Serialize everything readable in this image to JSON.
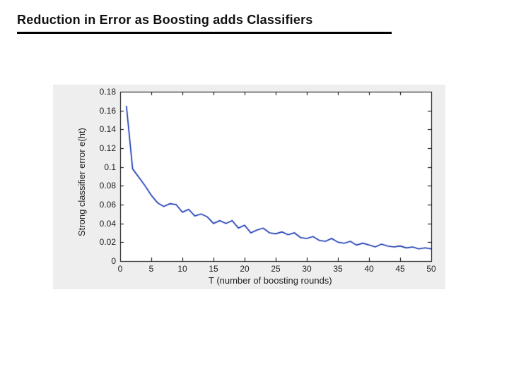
{
  "title": "Reduction in Error as Boosting adds Classifiers",
  "chart_data": {
    "type": "line",
    "xlabel": "T (number of boosting rounds)",
    "ylabel": "Strong classifier error e(ht)",
    "xlim": [
      0,
      50
    ],
    "ylim": [
      0,
      0.18
    ],
    "x_ticks": [
      0,
      5,
      10,
      15,
      20,
      25,
      30,
      35,
      40,
      45,
      50
    ],
    "y_ticks": [
      0,
      0.02,
      0.04,
      0.06,
      0.08,
      0.1,
      0.12,
      0.14,
      0.16,
      0.18
    ],
    "y_tick_labels": [
      "0",
      "0.02",
      "0.04",
      "0.06",
      "0.08",
      "0.1",
      "0.12",
      "0.14",
      "0.16",
      "0.18"
    ],
    "line_color": "#1030b0",
    "x": [
      1,
      2,
      3,
      4,
      5,
      6,
      7,
      8,
      9,
      10,
      11,
      12,
      13,
      14,
      15,
      16,
      17,
      18,
      19,
      20,
      21,
      22,
      23,
      24,
      25,
      26,
      27,
      28,
      29,
      30,
      31,
      32,
      33,
      34,
      35,
      36,
      37,
      38,
      39,
      40,
      41,
      42,
      43,
      44,
      45,
      46,
      47,
      48,
      49,
      50
    ],
    "y": [
      0.165,
      0.098,
      0.089,
      0.08,
      0.07,
      0.062,
      0.058,
      0.061,
      0.06,
      0.052,
      0.055,
      0.048,
      0.05,
      0.047,
      0.04,
      0.043,
      0.04,
      0.043,
      0.035,
      0.038,
      0.03,
      0.033,
      0.035,
      0.03,
      0.029,
      0.031,
      0.028,
      0.03,
      0.025,
      0.024,
      0.026,
      0.022,
      0.021,
      0.024,
      0.02,
      0.019,
      0.021,
      0.017,
      0.019,
      0.017,
      0.015,
      0.018,
      0.016,
      0.015,
      0.016,
      0.014,
      0.015,
      0.013,
      0.014,
      0.013
    ]
  }
}
